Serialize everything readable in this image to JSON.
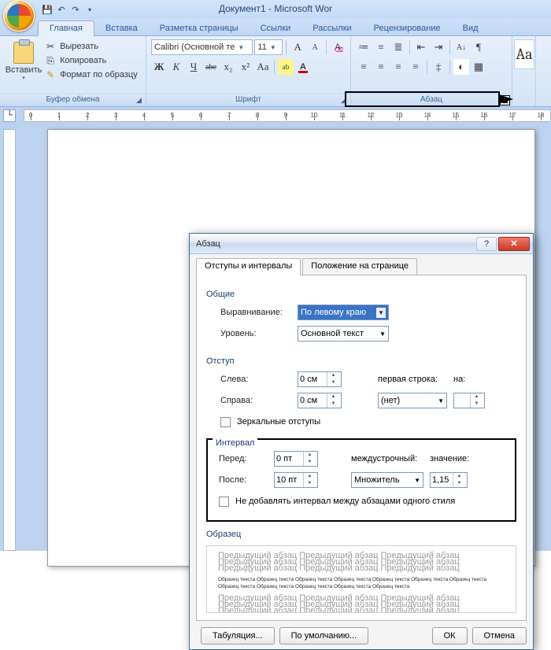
{
  "titlebar": {
    "doc_title": "Документ1 - Microsoft Wor"
  },
  "qat": {
    "save": "💾",
    "undo": "↶",
    "redo": "↷",
    "dd": "▾"
  },
  "tabs": {
    "home": "Главная",
    "insert": "Вставка",
    "layout": "Разметка страницы",
    "refs": "Ссылки",
    "mail": "Рассылки",
    "review": "Рецензирование",
    "view": "Вид"
  },
  "ribbon": {
    "clipboard": {
      "paste": "Вставить",
      "cut": "Вырезать",
      "copy": "Копировать",
      "format_painter": "Формат по образцу",
      "label": "Буфер обмена"
    },
    "font": {
      "name": "Calibri (Основной те",
      "size": "11",
      "grow": "A",
      "shrink": "A",
      "clear": "Aa",
      "bold": "Ж",
      "italic": "К",
      "under": "Ч",
      "strike": "abe",
      "sub": "x₂",
      "sup": "x²",
      "case": "Aa",
      "highlight": "ab",
      "color": "A",
      "label": "Шрифт"
    },
    "para": {
      "bullets": "•",
      "numbers": "1",
      "multilist": "a",
      "dec": "◀",
      "inc": "▶",
      "sort": "A↓",
      "marks": "¶",
      "al": "≡",
      "ac": "≡",
      "ar": "≡",
      "aj": "≡",
      "ls": "≡",
      "shade": "▦",
      "border": "▦",
      "label": "Абзац"
    },
    "styles": {
      "A": "Aa"
    }
  },
  "dialog": {
    "title": "Абзац",
    "tab1": "Отступы и интервалы",
    "tab2": "Положение на странице",
    "sec_general": "Общие",
    "alignment_lbl": "Выравнивание:",
    "alignment_val": "По левому краю",
    "level_lbl": "Уровень:",
    "level_val": "Основной текст",
    "sec_indent": "Отступ",
    "left_lbl": "Слева:",
    "left_val": "0 см",
    "right_lbl": "Справа:",
    "right_val": "0 см",
    "firstline_lbl": "первая строка:",
    "firstline_val": "(нет)",
    "by_lbl": "на:",
    "mirror_chk": "Зеркальные отступы",
    "sec_spacing": "Интервал",
    "before_lbl": "Перед:",
    "before_val": "0 пт",
    "after_lbl": "После:",
    "after_val": "10 пт",
    "linesp_lbl": "междустрочный:",
    "linesp_val": "Множитель",
    "at_lbl": "значение:",
    "at_val": "1,15",
    "nospace_chk": "Не добавлять интервал между абзацами одного стиля",
    "sec_preview": "Образец",
    "preview_faint": "Предыдущий абзац Предыдущий абзац Предыдущий абзац Предыдущий абзац Предыдущий абзац Предыдущий абзац Предыдущий абзац Предыдущий абзац Предыдущий абзац",
    "preview_emph": "Образец текста Образец текста Образец текста Образец текста Образец текста Образец текста Образец текста Образец текста Образец текста Образец текста Образец текста Образец текста",
    "tabs_btn": "Табуляция...",
    "default_btn": "По умолчанию...",
    "ok_btn": "ОК",
    "cancel_btn": "Отмена",
    "help": "?"
  }
}
